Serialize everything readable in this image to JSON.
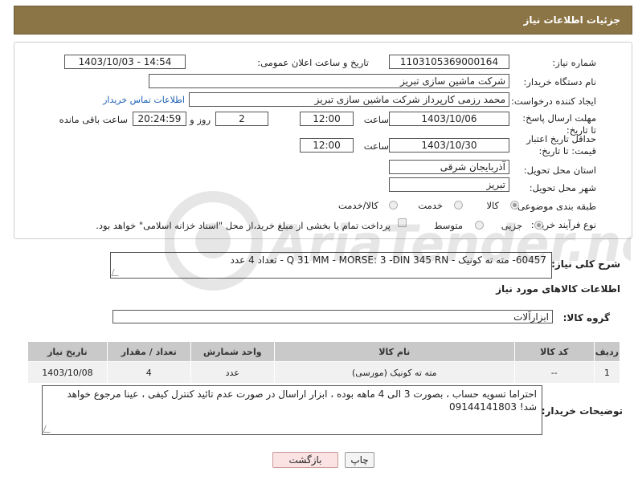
{
  "header": {
    "title": "جزئیات اطلاعات نیاز"
  },
  "form": {
    "need_number_label": "شماره نیاز:",
    "need_number": "1103105369000164",
    "announce_label": "تاریخ و ساعت اعلان عمومی:",
    "announce_value": "1403/10/03 - 14:54",
    "buyer_org_label": "نام دستگاه خریدار:",
    "buyer_org": "شرکت ماشین سازی تبریز",
    "requester_label": "ایجاد کننده درخواست:",
    "requester": "محمد رزمی کارپرداز شرکت ماشین سازی تبریز",
    "contact_link": "اطلاعات تماس خریدار",
    "deadline_label": "مهلت ارسال پاسخ: تا تاریخ:",
    "deadline_date": "1403/10/06",
    "time_label": "ساعت",
    "deadline_time": "12:00",
    "days_value": "2",
    "days_label": "روز و",
    "remaining_time": "20:24:59",
    "remaining_label": "ساعت باقی مانده",
    "price_validity_label": "حداقل تاریخ اعتبار قیمت: تا تاریخ:",
    "price_validity_date": "1403/10/30",
    "price_validity_time": "12:00",
    "province_label": "استان محل تحویل:",
    "province": "آذربایجان شرقی",
    "city_label": "شهر محل تحویل:",
    "city": "تبریز",
    "category_label": "طبقه بندی موضوعی:",
    "category_options": [
      "کالا",
      "خدمت",
      "کالا/خدمت"
    ],
    "category_selected": "کالا",
    "process_label": "نوع فرآیند خرید :",
    "process_options": [
      "جزیی",
      "متوسط"
    ],
    "process_selected": "جزیی",
    "payment_note": "پرداخت تمام یا بخشی از مبلغ خرید،از محل \"اسناد خزانه اسلامی\" خواهد بود."
  },
  "description": {
    "label": "شرح کلی نیاز:",
    "value": "60457- مته ته کونیک - Q 31 MM - MORSE: 3 -DIN 345 RN - تعداد 4 عدد"
  },
  "goods_info": {
    "title": "اطلاعات کالاهای مورد نیاز",
    "group_label": "گروه کالا:",
    "group_value": "ابزارآلات"
  },
  "table": {
    "headers": [
      "ردیف",
      "کد کالا",
      "نام کالا",
      "واحد شمارش",
      "تعداد / مقدار",
      "تاریخ نیاز"
    ],
    "rows": [
      [
        "1",
        "--",
        "مته ته کونیک (مورسی)",
        "عدد",
        "4",
        "1403/10/08"
      ]
    ]
  },
  "buyer_notes": {
    "label": "توضیحات خریدار:",
    "value": "احتراما تسویه حساب ، بصورت 3 الی 4 ماهه بوده ، ابزار اراسال در صورت عدم تائید کنترل کیفی ، عینا مرجوع خواهد شد! 09144141803"
  },
  "buttons": {
    "print": "چاپ",
    "back": "بازگشت"
  },
  "watermark": {
    "text": "AriaTender.neT"
  }
}
